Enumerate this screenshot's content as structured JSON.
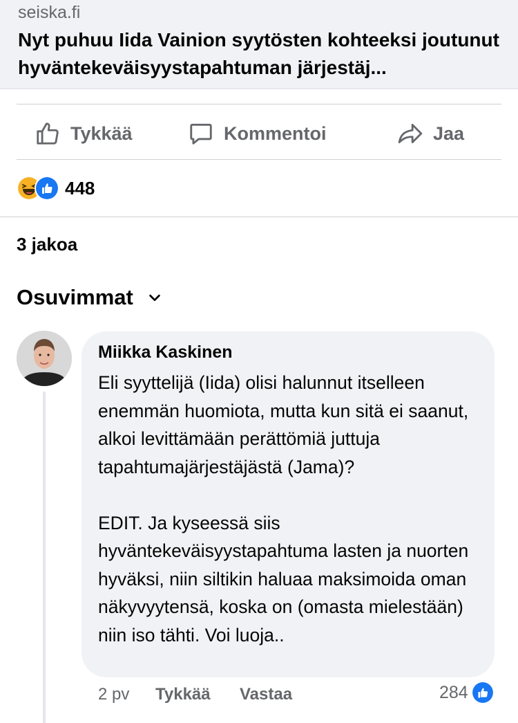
{
  "link_preview": {
    "domain": "seiska.fi",
    "title": "Nyt puhuu Iida Vainion syytösten kohteeksi joutunut hyväntekeväisyystapahtuman järjestäj..."
  },
  "actions": {
    "like": "Tykkää",
    "comment": "Kommentoi",
    "share": "Jaa"
  },
  "reactions": {
    "icons": [
      "haha-icon",
      "like-icon"
    ],
    "count": "448"
  },
  "shares": "3 jakoa",
  "sort": {
    "label": "Osuvimmat"
  },
  "comment": {
    "author": "Miikka Kaskinen",
    "text": "Eli syyttelijä (Iida) olisi halunnut itselleen enemmän huomiota, mutta kun sitä ei saanut, alkoi levittämään perättömiä juttuja tapahtumajärjestäjästä (Jama)?\n\nEDIT. Ja kyseessä siis hyväntekeväisyystapahtuma lasten ja nuorten hyväksi, niin siltikin haluaa maksimoida oman näkyvyytensä, koska on (omasta mielestään) niin iso tähti. Voi luoja..",
    "time": "2 pv",
    "like": "Tykkää",
    "reply": "Vastaa",
    "like_count": "284"
  },
  "colors": {
    "like_blue": "#1877f2",
    "haha_yellow": "#f7b125",
    "secondary_text": "#65676b",
    "bubble_bg": "#f0f2f5"
  }
}
